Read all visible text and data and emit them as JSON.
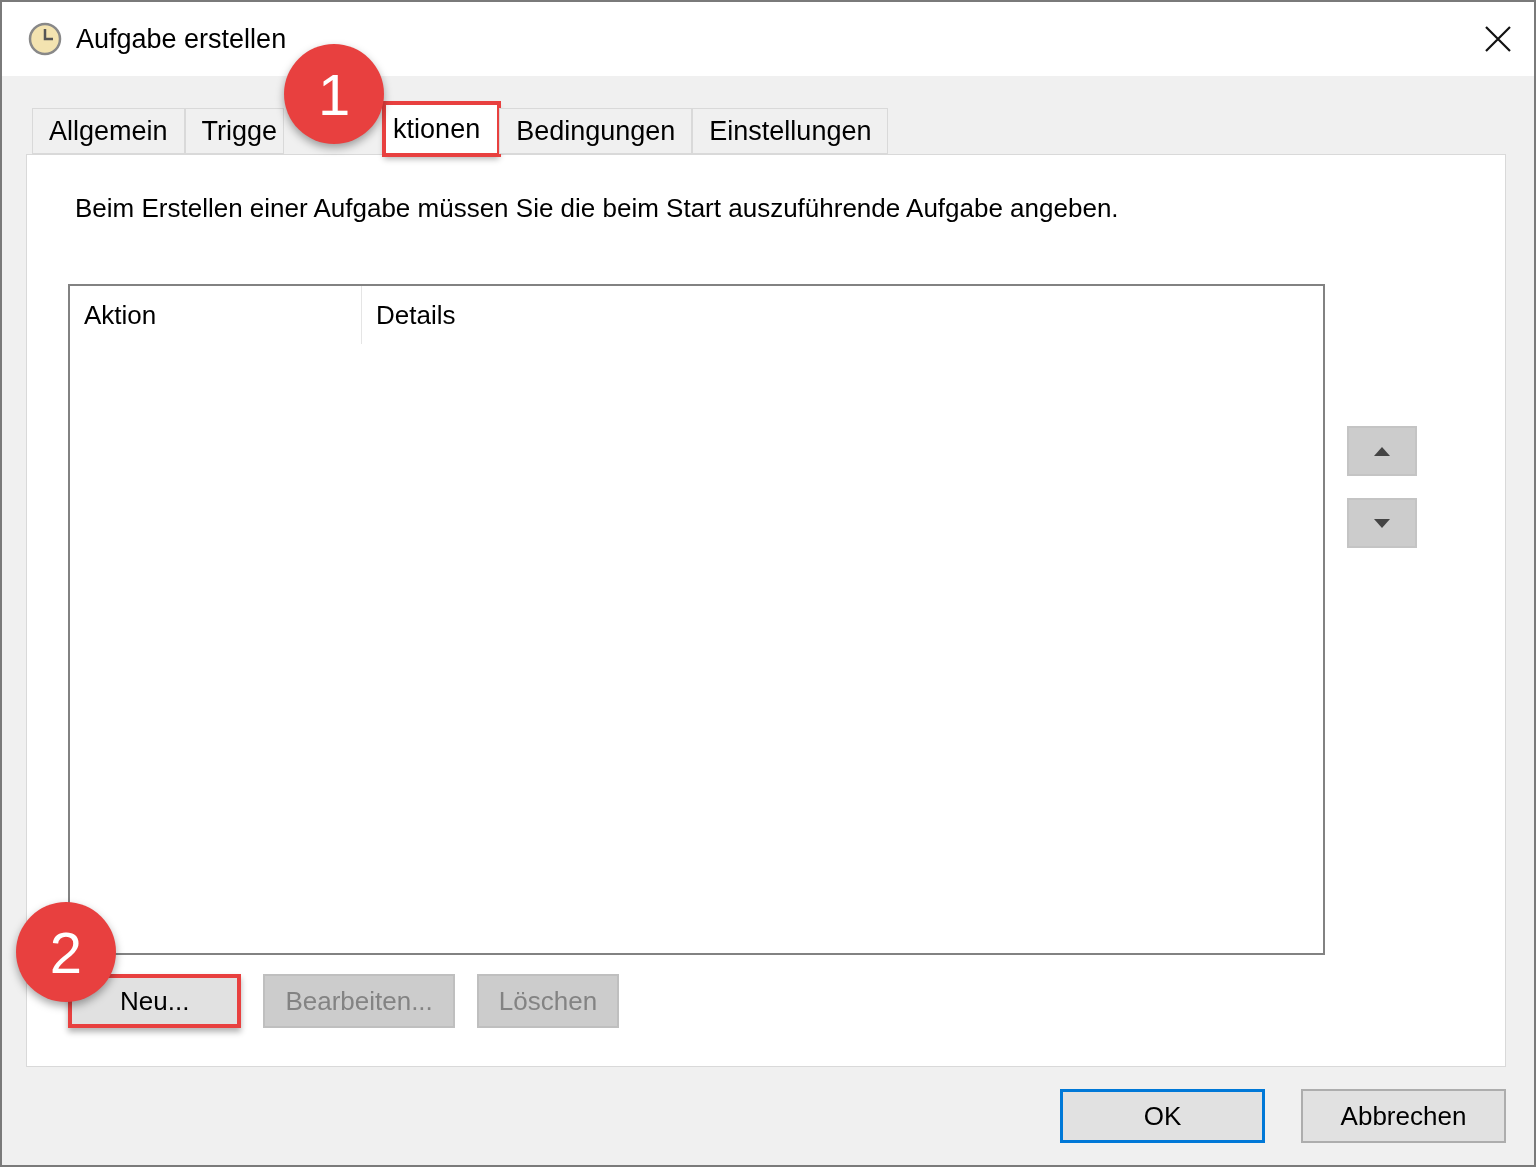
{
  "window": {
    "title": "Aufgabe erstellen"
  },
  "tabs": [
    {
      "label": "Allgemein",
      "selected": false,
      "highlighted": false
    },
    {
      "label": "Trigge",
      "selected": false,
      "highlighted": false
    },
    {
      "label": "ktionen",
      "selected": true,
      "highlighted": true,
      "callout": "1"
    },
    {
      "label": "Bedingungen",
      "selected": false,
      "highlighted": false
    },
    {
      "label": "Einstellungen",
      "selected": false,
      "highlighted": false
    }
  ],
  "description": "Beim Erstellen einer Aufgabe müssen Sie die beim Start auszuführende Aufgabe angeben.",
  "table": {
    "columns": [
      "Aktion",
      "Details"
    ]
  },
  "action_buttons": [
    {
      "label": "Neu...",
      "disabled": false,
      "highlighted": true,
      "callout": "2"
    },
    {
      "label": "Bearbeiten...",
      "disabled": true,
      "highlighted": false
    },
    {
      "label": "Löschen",
      "disabled": true,
      "highlighted": false
    }
  ],
  "dialog_buttons": [
    {
      "label": "OK",
      "default": true
    },
    {
      "label": "Abbrechen",
      "default": false
    }
  ]
}
